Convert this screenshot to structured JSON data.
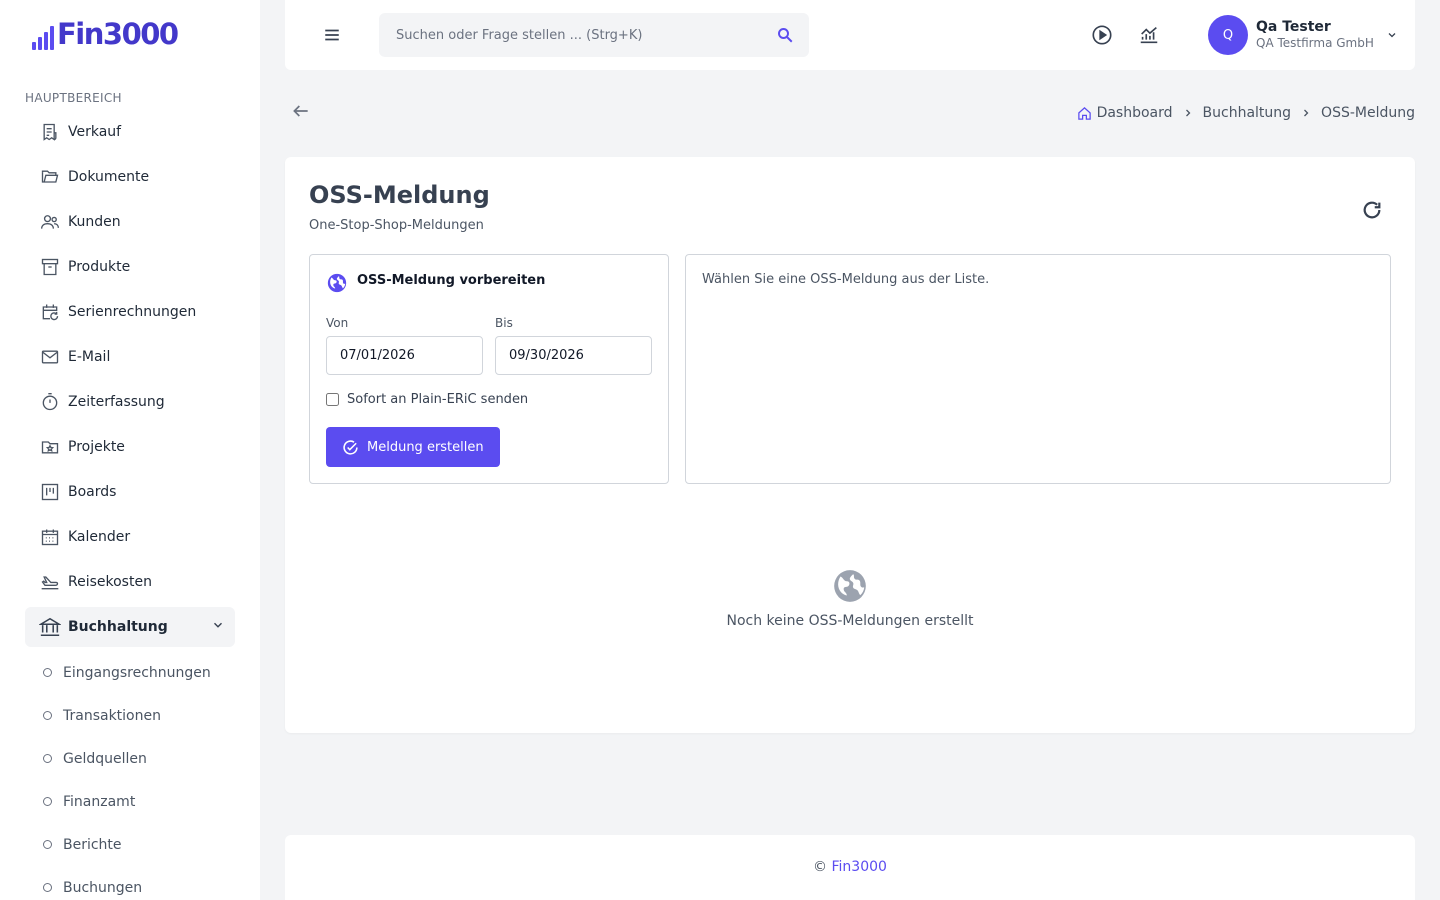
{
  "app": {
    "logo_text": "Fin3000",
    "brand_color": "#5b4cf0"
  },
  "sidebar": {
    "section_label": "HAUPTBEREICH",
    "items": [
      {
        "label": "Verkauf",
        "icon": "receipt-icon"
      },
      {
        "label": "Dokumente",
        "icon": "folder-open-icon"
      },
      {
        "label": "Kunden",
        "icon": "users-icon"
      },
      {
        "label": "Produkte",
        "icon": "archive-box-icon"
      },
      {
        "label": "Serienrechnungen",
        "icon": "calendar-repeat-icon"
      },
      {
        "label": "E-Mail",
        "icon": "envelope-icon"
      },
      {
        "label": "Zeiterfassung",
        "icon": "stopwatch-icon"
      },
      {
        "label": "Projekte",
        "icon": "folder-star-icon"
      },
      {
        "label": "Boards",
        "icon": "kanban-icon"
      },
      {
        "label": "Kalender",
        "icon": "calendar-icon"
      },
      {
        "label": "Reisekosten",
        "icon": "airplane-icon"
      },
      {
        "label": "Buchhaltung",
        "icon": "bank-icon",
        "expanded": true
      }
    ],
    "sub_items": [
      {
        "label": "Eingangsrechnungen"
      },
      {
        "label": "Transaktionen"
      },
      {
        "label": "Geldquellen"
      },
      {
        "label": "Finanzamt"
      },
      {
        "label": "Berichte"
      },
      {
        "label": "Buchungen"
      }
    ]
  },
  "header": {
    "search_placeholder": "Suchen oder Frage stellen ... (Strg+K)",
    "user": {
      "initial": "Q",
      "name": "Qa Tester",
      "company": "QA Testfirma GmbH"
    }
  },
  "breadcrumb": [
    "Dashboard",
    "Buchhaltung",
    "OSS-Meldung"
  ],
  "page": {
    "title": "OSS-Meldung",
    "subtitle": "One-Stop-Shop-Meldungen"
  },
  "prepare_panel": {
    "title": "OSS-Meldung vorbereiten",
    "from_label": "Von",
    "from_value": "07/01/2026",
    "to_label": "Bis",
    "to_value": "09/30/2026",
    "checkbox_label": "Sofort an Plain-ERiC senden",
    "checkbox_checked": false,
    "submit_label": "Meldung erstellen"
  },
  "detail_panel": {
    "hint": "Wählen Sie eine OSS-Meldung aus der Liste."
  },
  "empty_state": {
    "text": "Noch keine OSS-Meldungen erstellt"
  },
  "footer": {
    "copyright": "©",
    "brand": "Fin3000"
  }
}
